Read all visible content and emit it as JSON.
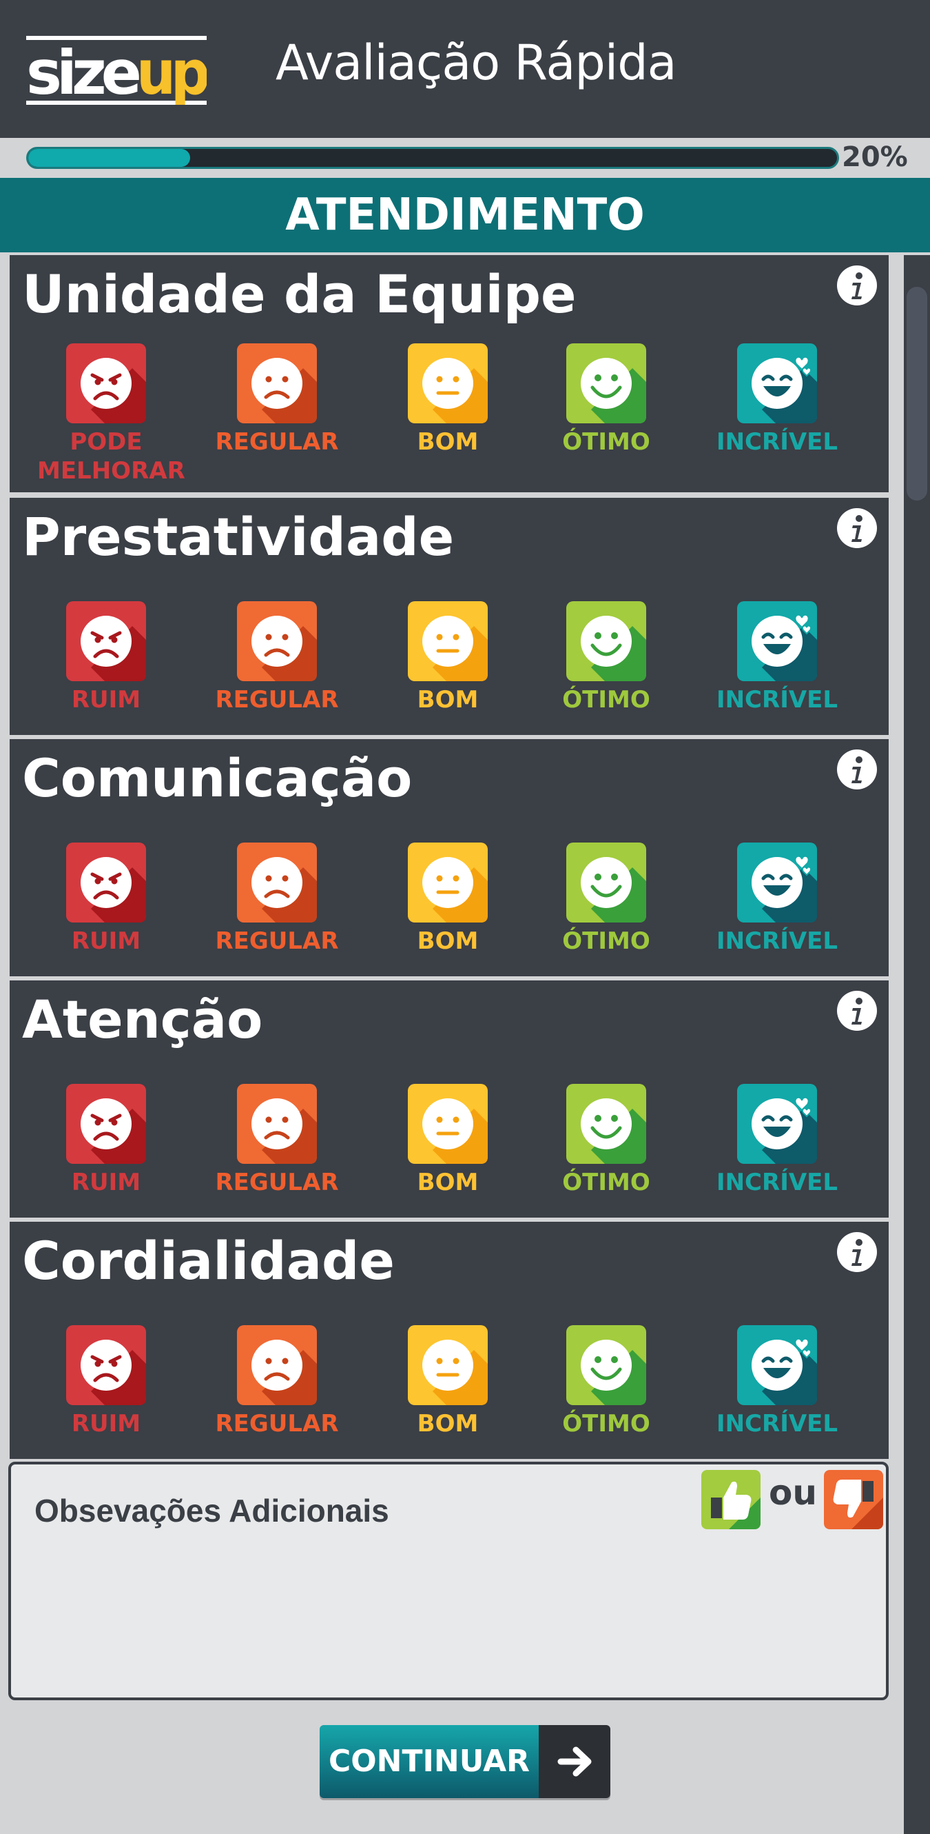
{
  "header": {
    "title": "Avaliação Rápida",
    "logo_text_left": "size",
    "logo_text_right": "up"
  },
  "progress": {
    "value": 0.2,
    "label": "20%"
  },
  "section": {
    "title": "ATENDIMENTO"
  },
  "criteria": [
    {
      "title": "Unidade da Equipe",
      "labels": [
        "PODE MELHORAR",
        "REGULAR",
        "BOM",
        "ÓTIMO",
        "INCRÍVEL"
      ]
    },
    {
      "title": "Prestatividade",
      "labels": [
        "RUIM",
        "REGULAR",
        "BOM",
        "ÓTIMO",
        "INCRÍVEL"
      ]
    },
    {
      "title": "Comunicação",
      "labels": [
        "RUIM",
        "REGULAR",
        "BOM",
        "ÓTIMO",
        "INCRÍVEL"
      ]
    },
    {
      "title": "Atenção",
      "labels": [
        "RUIM",
        "REGULAR",
        "BOM",
        "ÓTIMO",
        "INCRÍVEL"
      ]
    },
    {
      "title": "Cordialidade",
      "labels": [
        "RUIM",
        "REGULAR",
        "BOM",
        "ÓTIMO",
        "INCRÍVEL"
      ]
    }
  ],
  "rating_icons": [
    "angry-face-icon",
    "sad-face-icon",
    "neutral-face-icon",
    "happy-face-icon",
    "love-face-icon"
  ],
  "rating_colors": {
    "ruim": {
      "light": "#d53a3f",
      "dark": "#a8181d",
      "label": "#d13a3e"
    },
    "regular": {
      "light": "#f06a34",
      "dark": "#c7421a",
      "label": "#ef5e2e"
    },
    "bom": {
      "light": "#fdc52f",
      "dark": "#f5a20f",
      "label": "#fdc133"
    },
    "otimo": {
      "light": "#a3cc3f",
      "dark": "#3aa03a",
      "label": "#9fc93d"
    },
    "incrivel": {
      "light": "#12a9a8",
      "dark": "#0e5b6a",
      "label": "#16a8a6"
    }
  },
  "notes": {
    "label": "Obsevações Adicionais",
    "or_text": "ou",
    "value": ""
  },
  "continue_button": {
    "label": "CONTINUAR"
  },
  "colors": {
    "header_bg": "#3b3f46",
    "section_bg": "#0d7076",
    "progress_fill": "#10a9ac"
  }
}
